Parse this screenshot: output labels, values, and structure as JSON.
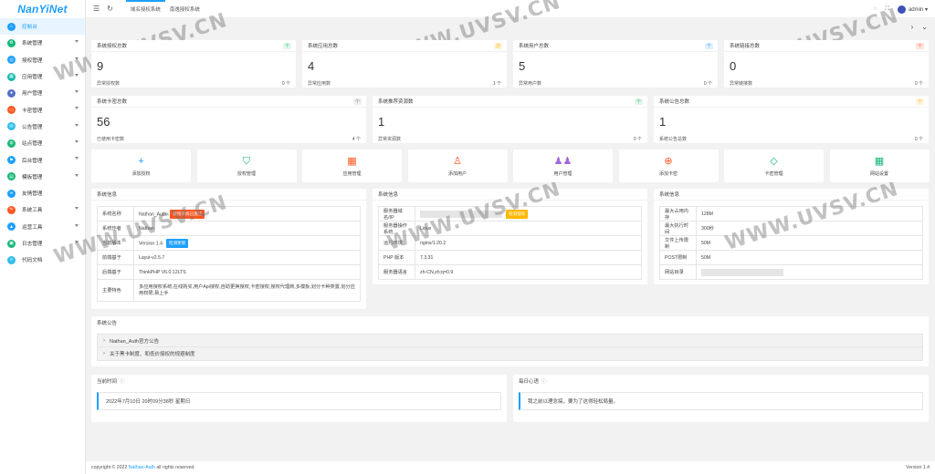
{
  "app": {
    "logo": "NanYiNet"
  },
  "sidebar": {
    "items": [
      {
        "label": "控制台",
        "color": "#1e9fff",
        "icon": "home-icon",
        "glyph": "⌂",
        "active": true,
        "arrow": false
      },
      {
        "label": "系统管理",
        "color": "#16b777",
        "icon": "system-icon",
        "glyph": "⚙",
        "arrow": true
      },
      {
        "label": "授权管理",
        "color": "#1e9fff",
        "icon": "auth-icon",
        "glyph": "◎",
        "arrow": true
      },
      {
        "label": "应用管理",
        "color": "#16baaa",
        "icon": "app-icon",
        "glyph": "▦",
        "arrow": true
      },
      {
        "label": "用户管理",
        "color": "#5470c6",
        "icon": "user-icon",
        "glyph": "●",
        "arrow": true
      },
      {
        "label": "卡密管理",
        "color": "#ff5722",
        "icon": "card-icon",
        "glyph": "▭",
        "arrow": true
      },
      {
        "label": "公告管理",
        "color": "#31bdec",
        "icon": "notice-icon",
        "glyph": "✉",
        "arrow": true
      },
      {
        "label": "站点管理",
        "color": "#16b777",
        "icon": "site-icon",
        "glyph": "◍",
        "arrow": true
      },
      {
        "label": "后台管理",
        "color": "#1e9fff",
        "icon": "admin-icon",
        "glyph": "⚑",
        "arrow": true
      },
      {
        "label": "模板管理",
        "color": "#16b777",
        "icon": "template-icon",
        "glyph": "▤",
        "arrow": true
      },
      {
        "label": "友情管理",
        "color": "#1e9fff",
        "icon": "link-icon",
        "glyph": "∞",
        "arrow": false
      },
      {
        "label": "系统工具",
        "color": "#ff5722",
        "icon": "tools-icon",
        "glyph": "✎",
        "arrow": true
      },
      {
        "label": "运营工具",
        "color": "#1e9fff",
        "icon": "ops-icon",
        "glyph": "▲",
        "arrow": true
      },
      {
        "label": "日志管理",
        "color": "#16b777",
        "icon": "log-icon",
        "glyph": "▣",
        "arrow": true
      },
      {
        "label": "代码文档",
        "color": "#31bdec",
        "icon": "doc-icon",
        "glyph": "≡",
        "arrow": false
      }
    ]
  },
  "topbar": {
    "tabs": [
      "域名授权系统",
      "南逸授权系统"
    ],
    "user": "admin"
  },
  "stats_row1": [
    {
      "title": "系统授权总数",
      "value": "9",
      "foot": "异常授权数",
      "foot_val": "0 个",
      "tag": "个",
      "tag_bg": "#e3f7e8",
      "tag_fg": "#16b777"
    },
    {
      "title": "系统应用总数",
      "value": "4",
      "foot": "异常应用数",
      "foot_val": "1 个",
      "tag": "次",
      "tag_bg": "#fff3dd",
      "tag_fg": "#ffb800"
    },
    {
      "title": "系统用户总数",
      "value": "5",
      "foot": "异常用户数",
      "foot_val": "0 个",
      "tag": "个",
      "tag_bg": "#e1f1ff",
      "tag_fg": "#1e9fff"
    },
    {
      "title": "系统链接总数",
      "value": "0",
      "foot": "异常链接数",
      "foot_val": "0 个",
      "tag": "个",
      "tag_bg": "#ffe5e0",
      "tag_fg": "#ff5722"
    }
  ],
  "stats_row2": [
    {
      "title": "系统卡密总数",
      "value": "56",
      "foot": "已使用卡密数",
      "foot_val": "4 个",
      "tag": "个",
      "tag_bg": "#eeeeee",
      "tag_fg": "#777"
    },
    {
      "title": "系统推荐资源数",
      "value": "1",
      "foot": "异常资源数",
      "foot_val": "0 个",
      "tag": "个",
      "tag_bg": "#e3f7e8",
      "tag_fg": "#16b777"
    },
    {
      "title": "系统公告总数",
      "value": "1",
      "foot": "系统公告总数",
      "foot_val": "0 个",
      "tag": "个",
      "tag_bg": "#fff3dd",
      "tag_fg": "#ffb800"
    }
  ],
  "quick": [
    {
      "label": "添加授权",
      "glyph": "+",
      "icon": "plus-icon",
      "color": "#1e9fff"
    },
    {
      "label": "授权管理",
      "glyph": "⛉",
      "icon": "shield-check-icon",
      "color": "#16b777"
    },
    {
      "label": "应用管理",
      "glyph": "▦",
      "icon": "apps-icon",
      "color": "#ff5722"
    },
    {
      "label": "添加用户",
      "glyph": "♙",
      "icon": "add-user-icon",
      "color": "#ff5722"
    },
    {
      "label": "用户管理",
      "glyph": "♟♟",
      "icon": "users-icon",
      "color": "#a06ad8"
    },
    {
      "label": "添加卡密",
      "glyph": "⊕",
      "icon": "add-card-icon",
      "color": "#ff5722"
    },
    {
      "label": "卡密管理",
      "glyph": "◇",
      "icon": "diamond-icon",
      "color": "#16b777"
    },
    {
      "label": "网站设置",
      "glyph": "▦",
      "icon": "windows-icon",
      "color": "#16b777"
    }
  ],
  "sysinfo": {
    "title": "系统信息",
    "rows": [
      {
        "k": "系统名称",
        "v": "Nathan_Auth",
        "btn": "授权系统已激活",
        "btn_bg": "#ff5722"
      },
      {
        "k": "系统作者",
        "v": "Nathan"
      },
      {
        "k": "当前版本",
        "v": "Version 1.4",
        "btn": "检测更新",
        "btn_bg": "#1e9fff"
      },
      {
        "k": "前端基于",
        "v": "Layui-v2.5.7"
      },
      {
        "k": "后端基于",
        "v": "ThinkPHP V6.0.12LTS"
      },
      {
        "k": "主要特色",
        "v": "多应用授权系统,在线购买,用户Api授权,自助更换授权,卡密授权,授权代理商,多模板,划分卡种类置,划分应用权限,易上手"
      }
    ]
  },
  "serverinfo": {
    "title": "系统信息",
    "rows": [
      {
        "k": "服务器域名/IP",
        "v": "",
        "btn": "检测授权",
        "btn_bg": "#ffb800"
      },
      {
        "k": "服务器操作系统",
        "v": "Linux"
      },
      {
        "k": "运行环境",
        "v": "nginx/1.20.2"
      },
      {
        "k": "PHP 版本",
        "v": "7.3.31"
      },
      {
        "k": "服务器语言",
        "v": "zh-CN,zh;q=0.9"
      }
    ]
  },
  "limits": {
    "title": "系统信息",
    "rows": [
      {
        "k": "最大占用内存",
        "v": "128M"
      },
      {
        "k": "最大执行时间",
        "v": "300秒"
      },
      {
        "k": "文件上传限制",
        "v": "50M"
      },
      {
        "k": "POST限制",
        "v": "50M"
      },
      {
        "k": "网站目录",
        "v": ""
      }
    ]
  },
  "notice": {
    "title": "系统公告",
    "items": [
      "Nathan_Auth官方公告",
      "关于黑卡制度、和低价授权的规避制度"
    ]
  },
  "time": {
    "title": "当前时间",
    "value": "2022年7月10日 20时09分38秒 星期日"
  },
  "mood": {
    "title": "每日心语",
    "value": "我之前以理念搞，要为了这得轻松局量。"
  },
  "footer": {
    "prefix": "copyright © 2022 ",
    "link": "Nathan-Auth",
    "suffix": " all rights reserved.",
    "version": "Version 1.4"
  },
  "watermark": "WWW.UVSV.CN"
}
